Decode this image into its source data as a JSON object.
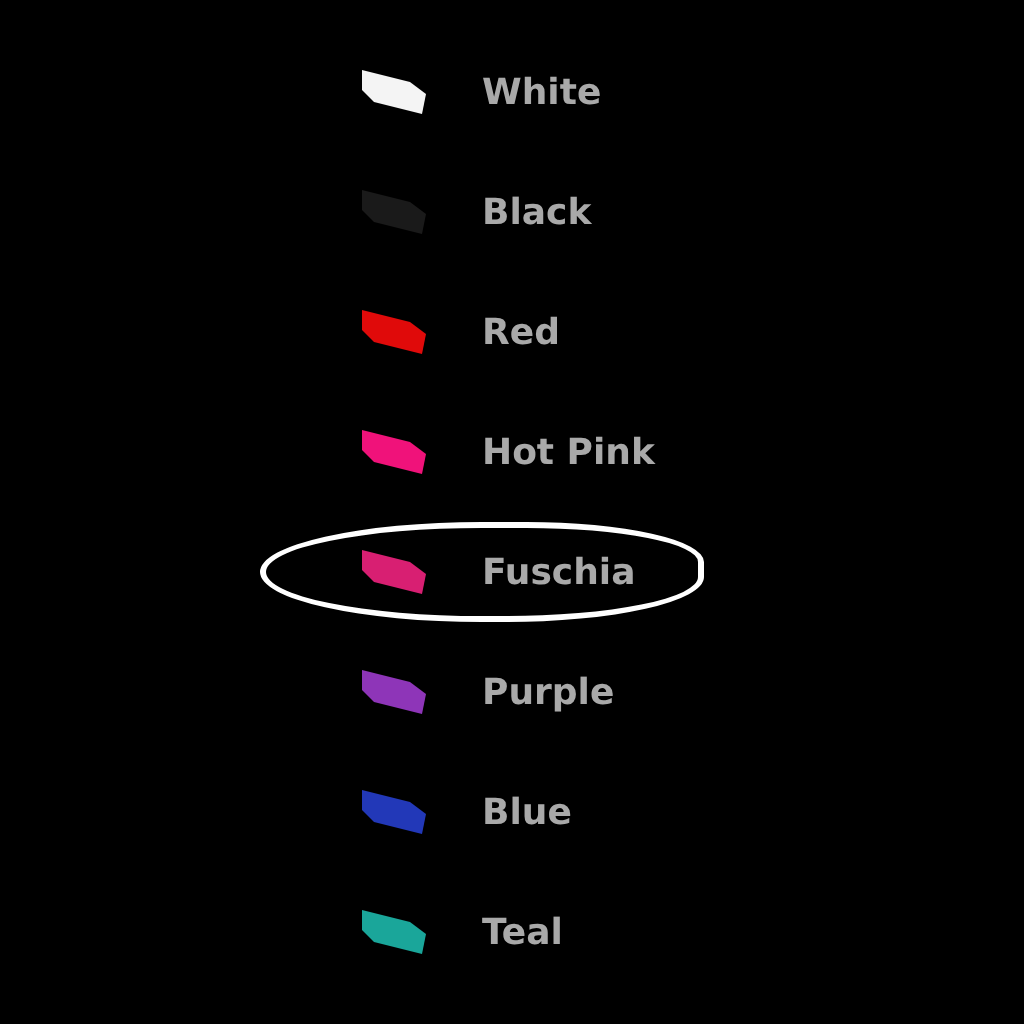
{
  "colors": [
    {
      "label": "White",
      "color": "#f4f4f4",
      "selected": false
    },
    {
      "label": "Black",
      "color": "#1a1a1a",
      "selected": false
    },
    {
      "label": "Red",
      "color": "#e00a0a",
      "selected": false
    },
    {
      "label": "Hot Pink",
      "color": "#f0127a",
      "selected": false
    },
    {
      "label": "Fuschia",
      "color": "#d81f72",
      "selected": true
    },
    {
      "label": "Purple",
      "color": "#8e35b8",
      "selected": false
    },
    {
      "label": "Blue",
      "color": "#2238b8",
      "selected": false
    },
    {
      "label": "Teal",
      "color": "#1aa69a",
      "selected": false
    }
  ]
}
